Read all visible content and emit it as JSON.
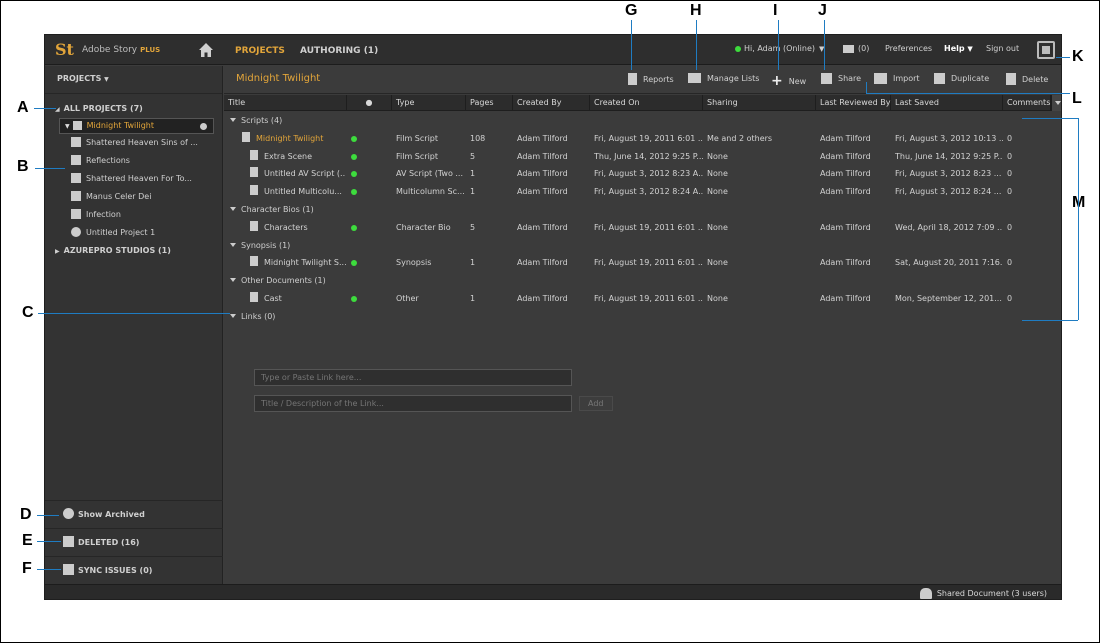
{
  "app": {
    "logo": "St",
    "brand_name": "Adobe Story",
    "brand_suffix": "PLUS",
    "nav": {
      "projects": "PROJECTS",
      "authoring": "AUTHORING (1)"
    },
    "user": "Hi, Adam (Online)",
    "mail_count": "(0)",
    "preferences": "Preferences",
    "help": "Help",
    "sign_out": "Sign out"
  },
  "sidebar": {
    "header": "PROJECTS",
    "all_projects": "ALL PROJECTS (7)",
    "items": [
      {
        "label": "Midnight Twilight"
      },
      {
        "label": "Shattered Heaven Sins of ..."
      },
      {
        "label": "Reflections"
      },
      {
        "label": "Shattered Heaven For To..."
      },
      {
        "label": "Manus Celer Dei"
      },
      {
        "label": "Infection"
      },
      {
        "label": "Untitled Project 1"
      }
    ],
    "studios": "AZUREPRO STUDIOS (1)",
    "show_archived": "Show Archived",
    "deleted": "DELETED (16)",
    "sync_issues": "SYNC ISSUES (0)"
  },
  "main": {
    "title": "Midnight Twilight",
    "toolbar": {
      "reports": "Reports",
      "manage_lists": "Manage Lists",
      "new": "New",
      "share": "Share",
      "import": "Import",
      "duplicate": "Duplicate",
      "delete": "Delete"
    },
    "columns": [
      "Title",
      "●",
      "Type",
      "Pages",
      "Created By",
      "Created On",
      "Sharing",
      "Last Reviewed By",
      "Last Saved",
      "Comments"
    ],
    "groups": [
      {
        "label": "Scripts (4)",
        "rows": [
          {
            "title": "Midnight Twilight",
            "type": "Film Script",
            "pages": "108",
            "created_by": "Adam Tilford",
            "created_on": "Fri, August 19, 2011 6:01 ...",
            "sharing": "Me and 2 others",
            "reviewed_by": "Adam Tilford",
            "last_saved": "Fri, August 3, 2012 10:13 ...",
            "comments": "0"
          },
          {
            "title": "Extra Scene",
            "type": "Film Script",
            "pages": "5",
            "created_by": "Adam Tilford",
            "created_on": "Thu, June 14, 2012 9:25 P...",
            "sharing": "None",
            "reviewed_by": "Adam Tilford",
            "last_saved": "Thu, June 14, 2012 9:25 P...",
            "comments": "0"
          },
          {
            "title": "Untitled AV Script (...",
            "type": "AV Script (Two ...",
            "pages": "1",
            "created_by": "Adam Tilford",
            "created_on": "Fri, August 3, 2012 8:23 A...",
            "sharing": "None",
            "reviewed_by": "Adam Tilford",
            "last_saved": "Fri, August 3, 2012 8:23 ...",
            "comments": "0"
          },
          {
            "title": "Untitled Multicolu...",
            "type": "Multicolumn Sc...",
            "pages": "1",
            "created_by": "Adam Tilford",
            "created_on": "Fri, August 3, 2012 8:24 A...",
            "sharing": "None",
            "reviewed_by": "Adam Tilford",
            "last_saved": "Fri, August 3, 2012 8:24 ...",
            "comments": "0"
          }
        ]
      },
      {
        "label": "Character Bios (1)",
        "rows": [
          {
            "title": "Characters",
            "type": "Character Bio",
            "pages": "5",
            "created_by": "Adam Tilford",
            "created_on": "Fri, August 19, 2011 6:01 ...",
            "sharing": "None",
            "reviewed_by": "Adam Tilford",
            "last_saved": "Wed, April 18, 2012 7:09 ...",
            "comments": "0"
          }
        ]
      },
      {
        "label": "Synopsis (1)",
        "rows": [
          {
            "title": "Midnight Twilight S...",
            "type": "Synopsis",
            "pages": "1",
            "created_by": "Adam Tilford",
            "created_on": "Fri, August 19, 2011 6:01 ...",
            "sharing": "None",
            "reviewed_by": "Adam Tilford",
            "last_saved": "Sat, August 20, 2011 7:16...",
            "comments": "0"
          }
        ]
      },
      {
        "label": "Other Documents (1)",
        "rows": [
          {
            "title": "Cast",
            "type": "Other",
            "pages": "1",
            "created_by": "Adam Tilford",
            "created_on": "Fri, August 19, 2011 6:01 ...",
            "sharing": "None",
            "reviewed_by": "Adam Tilford",
            "last_saved": "Mon, September 12, 201...",
            "comments": "0"
          }
        ]
      }
    ],
    "links_label": "Links (0)",
    "link_placeholder": "Type or Paste Link here...",
    "link_desc_placeholder": "Title / Description of the Link...",
    "add_button": "Add"
  },
  "status": {
    "text": "Shared Document (3 users)"
  },
  "annotations": [
    "A",
    "B",
    "C",
    "D",
    "E",
    "F",
    "G",
    "H",
    "I",
    "J",
    "K",
    "L",
    "M"
  ]
}
